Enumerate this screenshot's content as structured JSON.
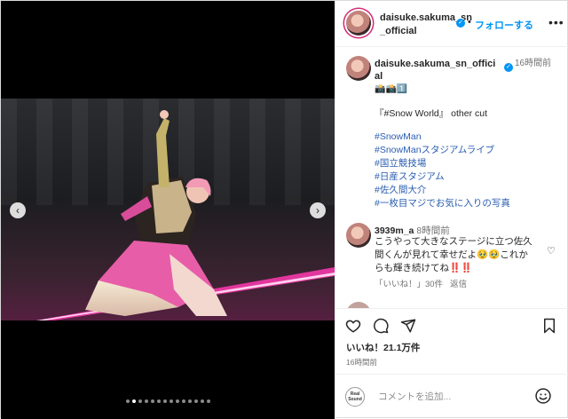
{
  "header": {
    "username": "daisuke.sakuma_sn_official",
    "follow_label": "フォローする",
    "separator": "•",
    "more_glyph": "•••"
  },
  "caption": {
    "username": "daisuke.sakuma_sn_official",
    "time": "16時間前",
    "emoji": "📸📸1️⃣",
    "title": "『#Snow World』 other cut",
    "hashtags": [
      "#SnowMan",
      "#SnowManスタジアムライブ",
      "#国立競技場",
      "#日産スタジアム",
      "#佐久間大介",
      "#一枚目マジでお気に入りの写真"
    ]
  },
  "comment": {
    "username": "3939m_a",
    "time": "8時間前",
    "text": "こうやって大きなステージに立つ佐久間くんが見れて幸せだよ🥹🥹これからも輝き続けてね‼️‼️",
    "likes": "「いいね！」30件",
    "reply_label": "返信"
  },
  "actions": {
    "likes": "いいね！21.1万件",
    "posted": "16時間前"
  },
  "add_comment": {
    "placeholder": "コメントを追加...",
    "badge": "Real Sound"
  },
  "carousel": {
    "prev_glyph": "‹",
    "next_glyph": "›",
    "count": 14,
    "active_index": 1
  },
  "colors": {
    "accent": "#0095f6",
    "hashtag": "#2a5db0",
    "story_ring": "#d62976",
    "stage_pink": "#ff3ab0"
  },
  "icons": {
    "like": "heart-icon",
    "comment": "comment-bubble-icon",
    "share": "paper-plane-icon",
    "save": "bookmark-icon",
    "emoji": "smiley-icon",
    "verified": "verified-badge-icon",
    "more": "more-options-icon"
  }
}
